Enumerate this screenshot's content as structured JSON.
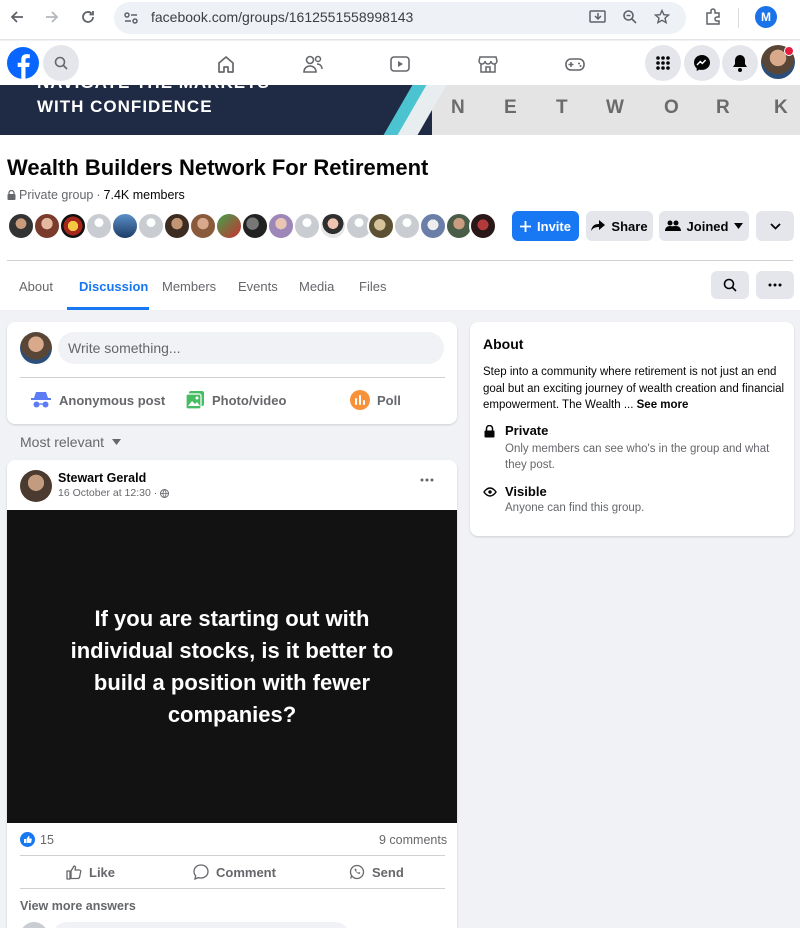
{
  "browser": {
    "url": "facebook.com/groups/1612551558998143",
    "profile_initial": "M"
  },
  "cover": {
    "line1": "NAVIGATE THE MARKETS",
    "line2": "WITH CONFIDENCE",
    "network_letters": [
      "N",
      "E",
      "T",
      "W",
      "O",
      "R",
      "K"
    ]
  },
  "group": {
    "name": "Wealth Builders Network For Retirement",
    "privacy": "Private group",
    "separator": "·",
    "member_count": "7.4K members"
  },
  "actions": {
    "invite": "Invite",
    "share": "Share",
    "joined": "Joined"
  },
  "tabs": [
    "About",
    "Discussion",
    "Members",
    "Events",
    "Media",
    "Files"
  ],
  "active_tab": "Discussion",
  "composer": {
    "placeholder": "Write something...",
    "anon": "Anonymous post",
    "photo": "Photo/video",
    "poll": "Poll"
  },
  "sort": {
    "label": "Most relevant"
  },
  "post": {
    "author": "Stewart Gerald",
    "time": "16 October at 12:30 ·",
    "text": "If you are starting out with individual stocks, is it better to build a position with fewer companies?",
    "reactions": "15",
    "comments": "9 comments",
    "like": "Like",
    "comment": "Comment",
    "send": "Send",
    "view_more": "View more answers"
  },
  "about": {
    "title": "About",
    "description": "Step into a community where retirement is not just an end goal but an exciting journey of wealth creation and financial empowerment. The Wealth ...",
    "see_more": "See more",
    "private_title": "Private",
    "private_desc": "Only members can see who's in the group and what they post.",
    "visible_title": "Visible",
    "visible_desc": "Anyone can find this group."
  },
  "colors": {
    "brand": "#1877f2",
    "notification_dot": "#e41e3f"
  }
}
